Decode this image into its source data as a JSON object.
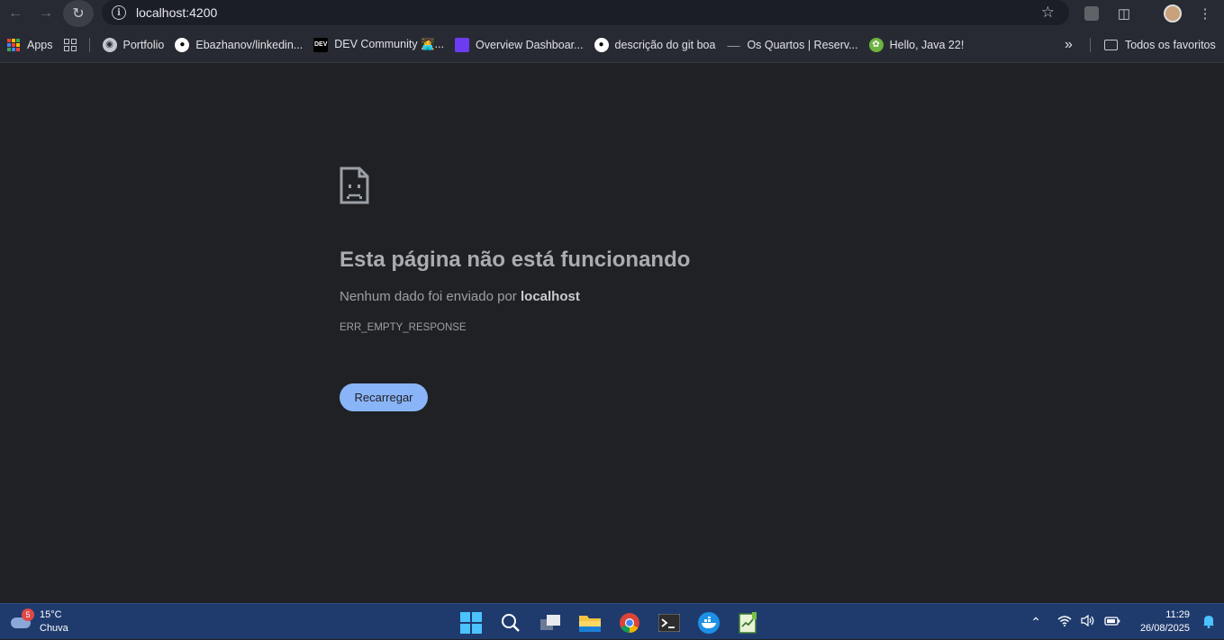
{
  "browser": {
    "url": "localhost:4200"
  },
  "bookmarks": {
    "apps_label": "Apps",
    "items": [
      {
        "label": "Portfolio"
      },
      {
        "label": "Ebazhanov/linkedin..."
      },
      {
        "label": "DEV Community 👩‍💻..."
      },
      {
        "label": "Overview Dashboar..."
      },
      {
        "label": "descrição do git boa"
      },
      {
        "label": "Os Quartos | Reserv..."
      },
      {
        "label": "Hello, Java 22!"
      }
    ],
    "more_label": "»",
    "all_bookmarks_label": "Todos os favoritos"
  },
  "error_page": {
    "title": "Esta página não está funcionando",
    "description_prefix": "Nenhum dado foi enviado por ",
    "description_host": "localhost",
    "error_code": "ERR_EMPTY_RESPONSE",
    "reload_label": "Recarregar"
  },
  "taskbar": {
    "weather_temp": "15°C",
    "weather_desc": "Chuva",
    "weather_badge": "5",
    "time": "11:29",
    "date": "26/08/2025"
  },
  "colors": {
    "page_bg": "#202124",
    "toolbar_bg": "#282a33",
    "button_bg": "#8ab4f8",
    "taskbar_bg": "#1f3b6e"
  }
}
